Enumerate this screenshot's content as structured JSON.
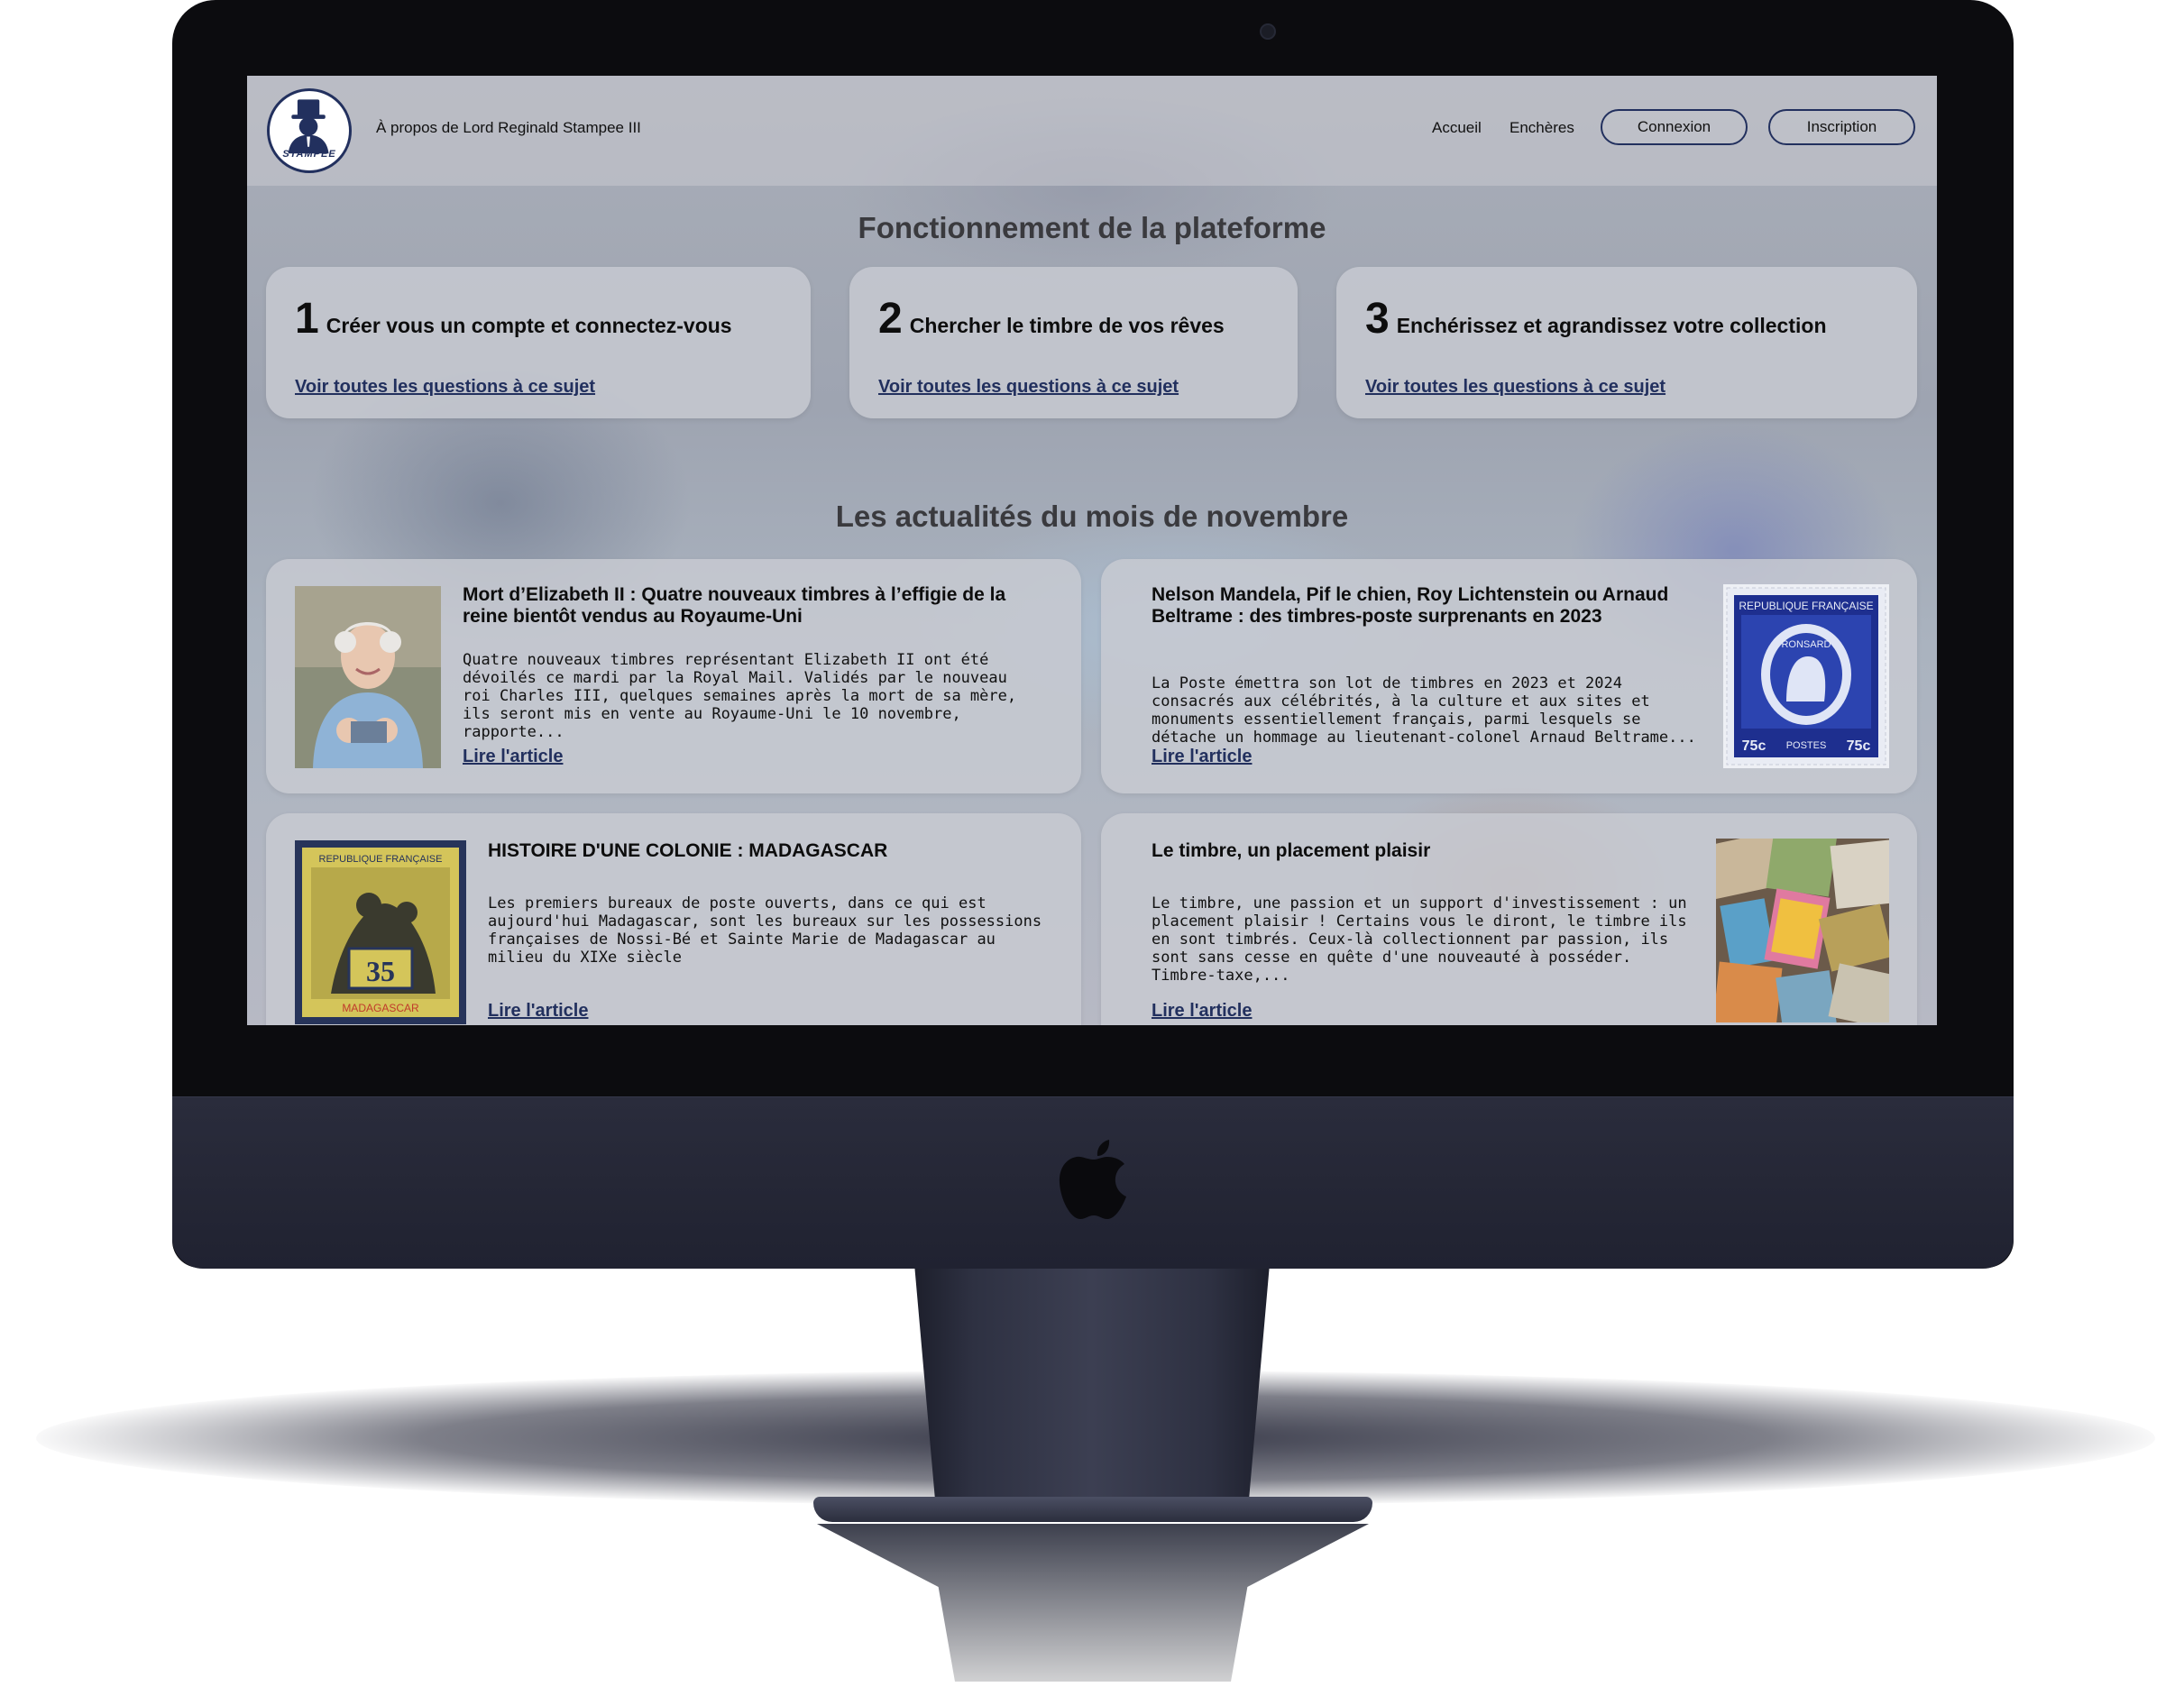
{
  "header": {
    "logo_text": "STAMPEE",
    "about_label": "À propos de Lord Reginald Stampee III",
    "nav": {
      "accueil": "Accueil",
      "encheres": "Enchères",
      "connexion": "Connexion",
      "inscription": "Inscription"
    }
  },
  "fonctionnement": {
    "title": "Fonctionnement de la plateforme",
    "steps": [
      {
        "number": "1",
        "text": "Créer vous un compte et connectez-vous",
        "link": "Voir toutes les questions à ce sujet"
      },
      {
        "number": "2",
        "text": "Chercher le timbre de vos rêves",
        "link": "Voir toutes les questions à ce sujet"
      },
      {
        "number": "3",
        "text": "Enchérissez et agrandissez votre collection",
        "link": "Voir toutes les questions à ce sujet"
      }
    ]
  },
  "actualites": {
    "title": "Les actualités du mois de novembre",
    "articles": [
      {
        "title": "Mort d’Elizabeth II : Quatre nouveaux timbres à l’effigie de la reine bientôt vendus au Royaume-Uni",
        "body": "Quatre nouveaux timbres représentant Elizabeth II ont été dévoilés ce mardi par la Royal Mail. Validés par le nouveau roi Charles III, quelques semaines après la mort de sa mère, ils seront mis en vente au Royaume-Uni le 10 novembre, rapporte...",
        "link": "Lire l'article"
      },
      {
        "title": "Nelson Mandela, Pif le chien, Roy Lichtenstein ou Arnaud Beltrame : des timbres-poste surprenants en 2023",
        "body": "La Poste émettra son lot de timbres en 2023 et 2024 consacrés aux célébrités, à la culture et aux sites et monuments essentiellement français, parmi lesquels se détache un hommage au lieutenant-colonel Arnaud Beltrame...",
        "link": "Lire l'article",
        "stamp": {
          "top": "REPUBLIQUE FRANÇAISE",
          "name": "RONSARD",
          "value": "75c",
          "bottom": "POSTES"
        }
      },
      {
        "title": "HISTOIRE D'UNE COLONIE : MADAGASCAR",
        "body": "Les premiers bureaux de poste ouverts, dans ce qui est aujourd'hui Madagascar, sont les bureaux sur les possessions françaises de Nossi-Bé et Sainte Marie de Madagascar au milieu du XIXe siècle",
        "link": "Lire l'article",
        "stamp": {
          "top": "REPUBLIQUE FRANÇAISE",
          "value": "35",
          "bottom": "MADAGASCAR"
        }
      },
      {
        "title": "Le timbre, un placement plaisir",
        "body": "Le timbre, une passion et un support d'investissement : un placement plaisir ! Certains vous le diront, le timbre ils en sont timbrés. Ceux-là collectionnent par passion, ils sont sans cesse en quête d'une nouveauté à posséder. Timbre-taxe,...",
        "link": "Lire l'article"
      }
    ]
  },
  "colors": {
    "accent": "#22305e",
    "text": "#0d0d0d",
    "card": "#c8cad2"
  }
}
